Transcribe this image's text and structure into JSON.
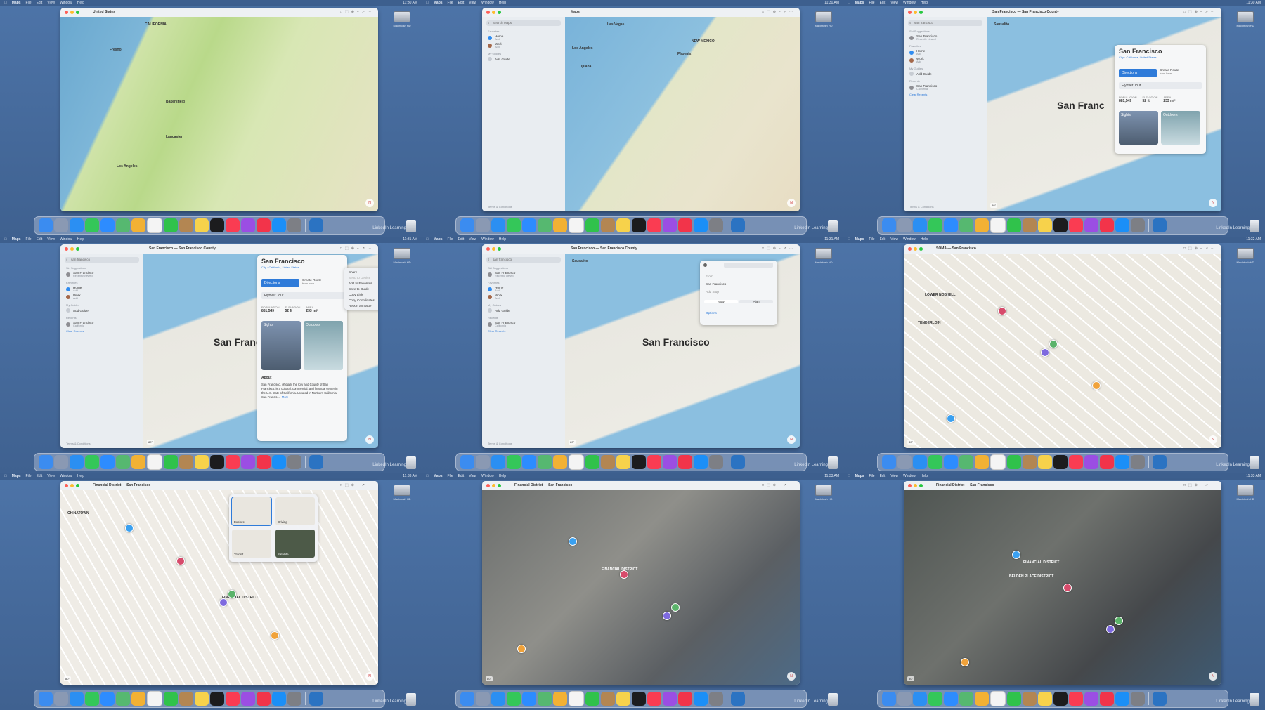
{
  "menubar": {
    "app": "Maps",
    "menus": [
      "File",
      "Edit",
      "View",
      "Window",
      "Help"
    ],
    "clock": [
      "11:30 AM",
      "11:30 AM",
      "11:30 AM",
      "11:31 AM",
      "11:31 AM",
      "11:32 AM",
      "11:33 AM",
      "11:33 AM",
      "11:33 AM"
    ]
  },
  "desktop": {
    "drive_label": "Macintosh HD"
  },
  "panels": [
    {
      "window_title": "United States",
      "labels": [
        "CALIFORNIA",
        "Fresno",
        "Bakersfield",
        "Los Angeles",
        "Lancaster"
      ],
      "big_label": ""
    },
    {
      "window_title": "Maps",
      "labels": [
        "Las Vegas",
        "Los Angeles",
        "Tijuana",
        "Phoenix",
        "NEW MEXICO"
      ],
      "big_label": ""
    },
    {
      "window_title": "San Francisco — San Francisco County",
      "labels": [
        "Sausalito"
      ],
      "big_label": "San Franc"
    },
    {
      "window_title": "San Francisco — San Francisco County",
      "labels": [],
      "big_label": "San Franc"
    },
    {
      "window_title": "San Francisco — San Francisco County",
      "labels": [
        "Sausalito"
      ],
      "big_label": "San Francisco"
    },
    {
      "window_title": "SOMA — San Francisco",
      "labels": [
        "LOWER NOB HILL",
        "TENDERLOIN"
      ],
      "big_label": ""
    },
    {
      "window_title": "Financial District — San Francisco",
      "labels": [
        "CHINATOWN",
        "FINANCIAL DISTRICT"
      ],
      "big_label": ""
    },
    {
      "window_title": "Financial District — San Francisco",
      "labels": [
        "FINANCIAL DISTRICT"
      ],
      "big_label": ""
    },
    {
      "window_title": "Financial District — San Francisco",
      "labels": [
        "FINANCIAL DISTRICT",
        "BELDEN PLACE DISTRICT"
      ],
      "big_label": ""
    }
  ],
  "sidebar": {
    "search_placeholder": "Search Maps",
    "search_query": "san francisco",
    "favorites_label": "Favorites",
    "suggestions_label": "Siri Suggestions",
    "my_guides_label": "My Guides",
    "recents_label": "Recents",
    "home_label": "Home",
    "work_label": "Work",
    "add_label": "Add",
    "add_guide_label": "Add Guide",
    "recent_place": "San Francisco",
    "recent_place_sub": "Recently viewed",
    "recents_place_sub": "California",
    "clear_recents_label": "Clear Recents",
    "terms_label": "Terms & Conditions"
  },
  "place_card": {
    "title": "San Francisco",
    "meta": "City · California, United States",
    "directions_label": "Directions",
    "create_route_label": "Create Route",
    "create_route_sub": "from here",
    "flyover_label": "Flyover Tour",
    "stats": [
      {
        "label": "POPULATION",
        "value": "881,549"
      },
      {
        "label": "ELEVATION",
        "value": "52 ft"
      },
      {
        "label": "AREA",
        "value": "233 mi²"
      }
    ],
    "sights_label": "Sights",
    "outdoors_label": "Outdoors",
    "about_title": "About",
    "about_text": "San Francisco, officially the City and County of San Francisco, is a cultural, commercial, and financial center in the U.S. state of California. Located in Northern California, San Francis...",
    "more_label": "More"
  },
  "context_menu": {
    "items": [
      "Share",
      "Send to Device",
      "Add to Favorites",
      "Save to Guide",
      "Copy Link",
      "Copy Coordinates",
      "Report an Issue"
    ]
  },
  "directions": {
    "from_label": "From",
    "to_label": "San Francisco",
    "add_stop_label": "Add Stop",
    "now_label": "Now",
    "plan_label": "Plan",
    "options_label": "Options"
  },
  "map_types": [
    {
      "label": "Explore",
      "color": "#e9e6df"
    },
    {
      "label": "Driving",
      "color": "#e9e6df"
    },
    {
      "label": "Transit",
      "color": "#e9e6df"
    },
    {
      "label": "Satellite",
      "color": "#4d5a48"
    }
  ],
  "weather": "80°",
  "compass": "N",
  "dock": {
    "linkedin_label": "LinkedIn Learning",
    "icons": [
      {
        "name": "finder-icon",
        "color": "#3b8cf0"
      },
      {
        "name": "launchpad-icon",
        "color": "#8a99b3"
      },
      {
        "name": "safari-icon",
        "color": "#2b8ff2"
      },
      {
        "name": "messages-icon",
        "color": "#34c759"
      },
      {
        "name": "mail-icon",
        "color": "#2d8cff"
      },
      {
        "name": "maps-icon",
        "color": "#56b870"
      },
      {
        "name": "photos-icon",
        "color": "#f2b134"
      },
      {
        "name": "reminders-icon",
        "color": "#f4f4f4"
      },
      {
        "name": "facetime-icon",
        "color": "#30c24b"
      },
      {
        "name": "contacts-icon",
        "color": "#b38652"
      },
      {
        "name": "notes-icon",
        "color": "#f7d24b"
      },
      {
        "name": "tv-icon",
        "color": "#1c1c1e"
      },
      {
        "name": "music-icon",
        "color": "#fa3c52"
      },
      {
        "name": "podcasts-icon",
        "color": "#9b4ee3"
      },
      {
        "name": "news-icon",
        "color": "#f2344a"
      },
      {
        "name": "app-store-icon",
        "color": "#1b8ff7"
      },
      {
        "name": "system-settings-icon",
        "color": "#7d7f85"
      }
    ]
  }
}
